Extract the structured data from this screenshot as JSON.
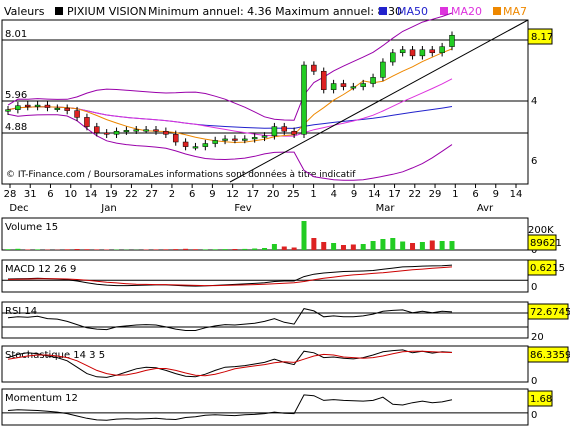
{
  "header": {
    "valeurs_label": "Valeurs",
    "stock_name": "PIXIUM VISION",
    "range_text": "Minimum annuel: 4.36 Maximum annuel: 8.30",
    "ma_labels": [
      "MA50",
      "MA20",
      "MA7"
    ],
    "ma_colors": [
      "#2222cc",
      "#dd33dd",
      "#ee8800"
    ]
  },
  "watermark": "© IT-Finance.com / BoursoramaLes informations sont données à titre indicatif",
  "chart_data": [
    {
      "type": "candlestick",
      "name": "price",
      "y_ticks": [
        4,
        6
      ],
      "y_left_labels": [
        "8.01",
        "5.96",
        "4.88"
      ],
      "last_value": "8.17",
      "ylim": [
        3.4,
        8.6
      ],
      "x_tick_labels": [
        "28",
        "31",
        "6",
        "10",
        "14",
        "19",
        "22",
        "27",
        "2",
        "6",
        "9",
        "12",
        "17",
        "20",
        "25",
        "1",
        "4",
        "9",
        "14",
        "17",
        "22",
        "29",
        "1",
        "6",
        "9",
        "14"
      ],
      "months": [
        "Dec",
        "Jan",
        "Fev",
        "Mar",
        "Avr"
      ],
      "close": [
        5.75,
        5.88,
        5.85,
        5.9,
        5.82,
        5.8,
        5.72,
        5.5,
        5.2,
        5.0,
        4.95,
        5.05,
        5.08,
        5.1,
        5.1,
        5.05,
        4.95,
        4.7,
        4.55,
        4.55,
        4.65,
        4.75,
        4.8,
        4.78,
        4.8,
        4.85,
        4.9,
        5.2,
        5.05,
        4.95,
        7.2,
        7.0,
        6.4,
        6.6,
        6.5,
        6.5,
        6.6,
        6.8,
        7.3,
        7.6,
        7.7,
        7.5,
        7.7,
        7.6,
        7.8,
        8.17
      ],
      "open": [
        5.7,
        5.75,
        5.9,
        5.85,
        5.9,
        5.8,
        5.8,
        5.72,
        5.5,
        5.2,
        5.0,
        4.95,
        5.05,
        5.08,
        5.1,
        5.1,
        5.05,
        4.95,
        4.7,
        4.55,
        4.55,
        4.65,
        4.75,
        4.8,
        4.78,
        4.8,
        4.85,
        4.9,
        5.2,
        5.05,
        4.95,
        7.2,
        7.0,
        6.4,
        6.6,
        6.5,
        6.5,
        6.6,
        6.8,
        7.3,
        7.6,
        7.7,
        7.5,
        7.7,
        7.6,
        7.8
      ]
    },
    {
      "type": "bar",
      "name": "Volume 15",
      "title": "Volume 15",
      "y_ticks": [
        "200K",
        "0"
      ],
      "last_value": "89621",
      "ylim": [
        0,
        300000
      ],
      "values": [
        8000,
        12000,
        5000,
        6000,
        4000,
        3000,
        7000,
        10000,
        8000,
        6000,
        5000,
        4000,
        3000,
        2000,
        5000,
        6000,
        7000,
        9000,
        12000,
        8000,
        6000,
        7000,
        9000,
        10000,
        11000,
        15000,
        20000,
        60000,
        35000,
        25000,
        290000,
        120000,
        80000,
        70000,
        50000,
        55000,
        60000,
        90000,
        110000,
        120000,
        85000,
        70000,
        80000,
        95000,
        90000,
        89621
      ],
      "up": [
        1,
        1,
        0,
        1,
        0,
        0,
        0,
        0,
        0,
        0,
        0,
        1,
        1,
        1,
        0,
        0,
        0,
        0,
        0,
        0,
        1,
        1,
        1,
        0,
        1,
        1,
        1,
        1,
        0,
        0,
        1,
        0,
        0,
        1,
        0,
        0,
        1,
        1,
        1,
        1,
        1,
        0,
        1,
        0,
        1,
        1
      ]
    },
    {
      "type": "line",
      "name": "MACD 12 26 9",
      "title": "MACD 12 26 9",
      "y_ticks": [
        "0"
      ],
      "last_value": "0.6215",
      "ylim": [
        -0.4,
        0.75
      ],
      "series": [
        {
          "name": "MACD",
          "values": [
            0.05,
            0.06,
            0.07,
            0.08,
            0.07,
            0.05,
            0.02,
            -0.03,
            -0.1,
            -0.16,
            -0.2,
            -0.22,
            -0.22,
            -0.21,
            -0.2,
            -0.19,
            -0.19,
            -0.21,
            -0.23,
            -0.24,
            -0.23,
            -0.21,
            -0.19,
            -0.17,
            -0.15,
            -0.13,
            -0.1,
            -0.05,
            -0.03,
            -0.03,
            0.15,
            0.25,
            0.3,
            0.33,
            0.36,
            0.37,
            0.38,
            0.4,
            0.45,
            0.5,
            0.55,
            0.56,
            0.58,
            0.59,
            0.6,
            0.6215
          ]
        },
        {
          "name": "Signal",
          "values": [
            0.03,
            0.04,
            0.05,
            0.06,
            0.06,
            0.06,
            0.05,
            0.03,
            0.0,
            -0.04,
            -0.08,
            -0.11,
            -0.14,
            -0.16,
            -0.17,
            -0.18,
            -0.18,
            -0.19,
            -0.2,
            -0.21,
            -0.22,
            -0.22,
            -0.21,
            -0.2,
            -0.19,
            -0.18,
            -0.16,
            -0.14,
            -0.12,
            -0.1,
            -0.05,
            0.02,
            0.08,
            0.13,
            0.18,
            0.22,
            0.25,
            0.28,
            0.31,
            0.35,
            0.39,
            0.43,
            0.46,
            0.49,
            0.52,
            0.55
          ]
        }
      ]
    },
    {
      "type": "line",
      "name": "RSI 14",
      "title": "RSI 14",
      "y_ticks": [
        "20"
      ],
      "last_value": "72.6745",
      "ylim": [
        20,
        90
      ],
      "series": [
        {
          "name": "RSI",
          "values": [
            60,
            62,
            61,
            63,
            58,
            57,
            52,
            45,
            38,
            35,
            34,
            40,
            42,
            44,
            45,
            44,
            40,
            35,
            32,
            32,
            38,
            42,
            45,
            44,
            46,
            48,
            52,
            58,
            50,
            46,
            80,
            75,
            62,
            64,
            62,
            62,
            64,
            68,
            74,
            76,
            77,
            71,
            74,
            71,
            74,
            72.6745
          ]
        }
      ]
    },
    {
      "type": "line",
      "name": "Stochastique 14 3 5",
      "title": "Stochastique 14 3 5",
      "y_ticks": [
        "0"
      ],
      "last_value": "86.3359",
      "ylim": [
        0,
        100
      ],
      "series": [
        {
          "name": "K",
          "values": [
            70,
            80,
            85,
            82,
            75,
            70,
            60,
            40,
            20,
            10,
            8,
            15,
            25,
            35,
            40,
            38,
            30,
            20,
            12,
            10,
            18,
            30,
            40,
            42,
            45,
            50,
            55,
            65,
            55,
            48,
            90,
            85,
            70,
            72,
            68,
            66,
            70,
            78,
            88,
            92,
            94,
            85,
            90,
            84,
            88,
            86.3359
          ]
        },
        {
          "name": "D",
          "values": [
            65,
            70,
            75,
            78,
            78,
            75,
            70,
            60,
            45,
            30,
            20,
            15,
            16,
            22,
            30,
            36,
            36,
            30,
            22,
            15,
            13,
            18,
            26,
            35,
            40,
            44,
            48,
            54,
            57,
            55,
            65,
            75,
            80,
            78,
            72,
            70,
            68,
            70,
            75,
            82,
            88,
            90,
            90,
            88,
            87,
            86
          ]
        }
      ]
    },
    {
      "type": "line",
      "name": "Momentum 12",
      "title": "Momentum 12",
      "y_ticks": [
        "0"
      ],
      "last_value": "1.68",
      "ylim": [
        -1.3,
        2.8
      ],
      "series": [
        {
          "name": "Momentum",
          "values": [
            0.3,
            0.4,
            0.35,
            0.3,
            0.2,
            0.1,
            -0.1,
            -0.4,
            -0.7,
            -0.9,
            -0.95,
            -0.8,
            -0.75,
            -0.8,
            -0.75,
            -0.7,
            -0.8,
            -0.85,
            -0.6,
            -0.5,
            -0.3,
            -0.25,
            -0.3,
            -0.35,
            -0.25,
            -0.2,
            -0.1,
            0.1,
            -0.05,
            -0.1,
            2.3,
            2.2,
            1.6,
            1.7,
            1.6,
            1.55,
            1.5,
            1.6,
            2.0,
            1.1,
            1.0,
            1.3,
            1.5,
            1.3,
            1.4,
            1.68
          ]
        }
      ]
    }
  ]
}
